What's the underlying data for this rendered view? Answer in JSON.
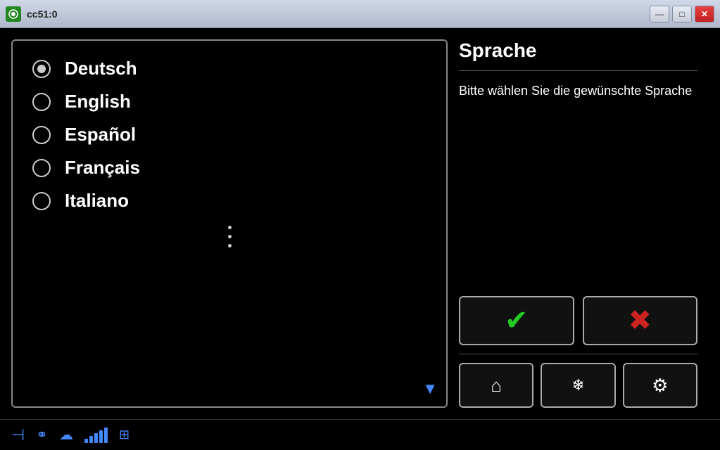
{
  "titleBar": {
    "title": "cc51:0",
    "minimizeLabel": "—",
    "maximizeLabel": "□",
    "closeLabel": "✕"
  },
  "leftPanel": {
    "languages": [
      {
        "id": "deutsch",
        "label": "Deutsch",
        "selected": true
      },
      {
        "id": "english",
        "label": "English",
        "selected": false
      },
      {
        "id": "espanol",
        "label": "Español",
        "selected": false
      },
      {
        "id": "francais",
        "label": "Français",
        "selected": false
      },
      {
        "id": "italiano",
        "label": "Italiano",
        "selected": false
      }
    ]
  },
  "rightPanel": {
    "title": "Sprache",
    "description": "Bitte wählen Sie die gewünschte Sprache",
    "confirmIcon": "✔",
    "cancelIcon": "✖"
  },
  "statusBar": {
    "signalBars": [
      4,
      8,
      12,
      16,
      20
    ],
    "icons": [
      "menu-icon",
      "connection-icon",
      "wifi-icon",
      "signal-icon",
      "network-icon"
    ]
  }
}
